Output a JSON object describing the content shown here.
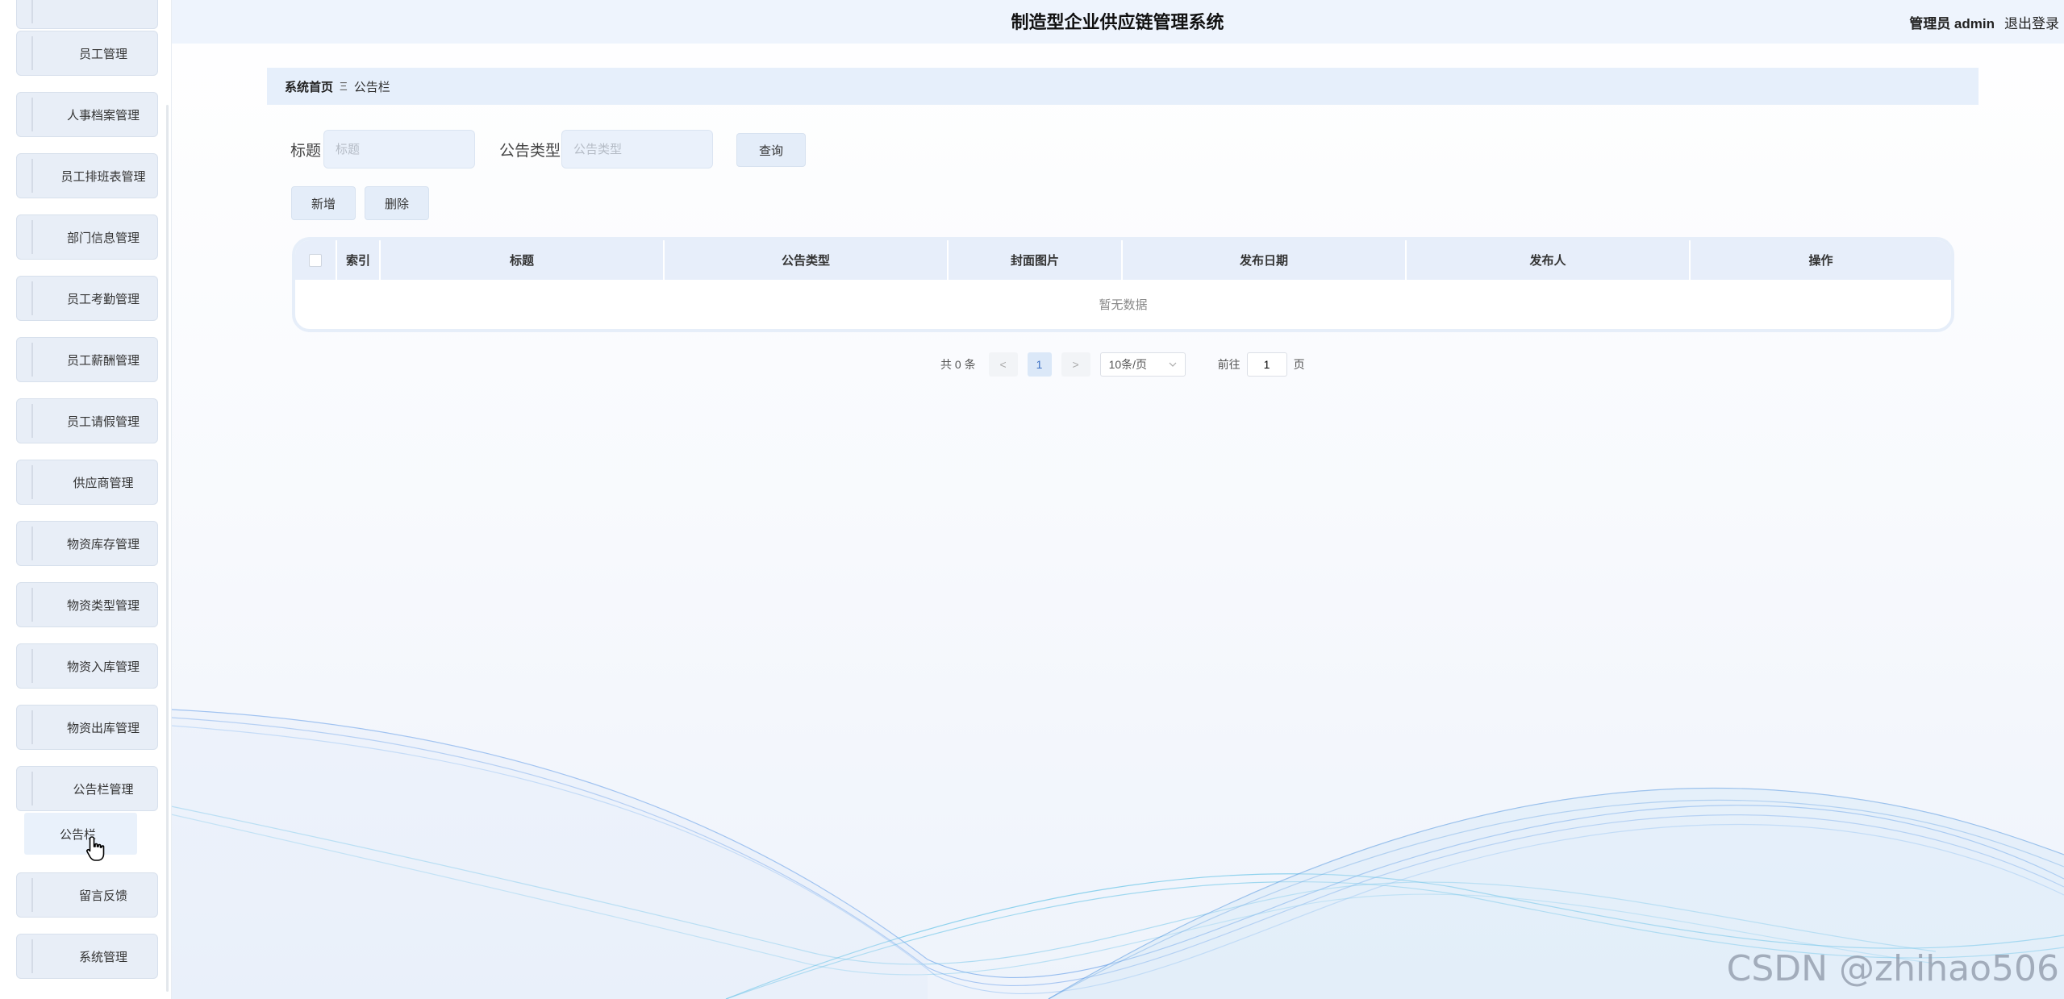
{
  "header": {
    "title": "制造型企业供应链管理系统",
    "user": "管理员 admin",
    "logout": "退出登录"
  },
  "sidebar": {
    "items": [
      {
        "label": "员工管理"
      },
      {
        "label": "人事档案管理"
      },
      {
        "label": "员工排班表管理"
      },
      {
        "label": "部门信息管理"
      },
      {
        "label": "员工考勤管理"
      },
      {
        "label": "员工薪酬管理"
      },
      {
        "label": "员工请假管理"
      },
      {
        "label": "供应商管理"
      },
      {
        "label": "物资库存管理"
      },
      {
        "label": "物资类型管理"
      },
      {
        "label": "物资入库管理"
      },
      {
        "label": "物资出库管理"
      },
      {
        "label": "公告栏管理"
      },
      {
        "label": "留言反馈"
      },
      {
        "label": "系统管理"
      }
    ],
    "active_sub": "公告栏"
  },
  "breadcrumb": {
    "home": "系统首页",
    "separator": "Ξ",
    "current": "公告栏"
  },
  "search": {
    "title_label": "标题",
    "title_placeholder": "标题",
    "type_label": "公告类型",
    "type_placeholder": "公告类型",
    "query_button": "查询"
  },
  "actions": {
    "add": "新增",
    "delete": "删除"
  },
  "table": {
    "columns": [
      "索引",
      "标题",
      "公告类型",
      "封面图片",
      "发布日期",
      "发布人",
      "操作"
    ],
    "empty_text": "暂无数据"
  },
  "pagination": {
    "total": "共 0 条",
    "prev": "<",
    "page": "1",
    "next": ">",
    "page_size": "10条/页",
    "goto_label": "前往",
    "goto_value": "1",
    "page_unit": "页"
  },
  "watermark": "CSDN @zhihao506"
}
